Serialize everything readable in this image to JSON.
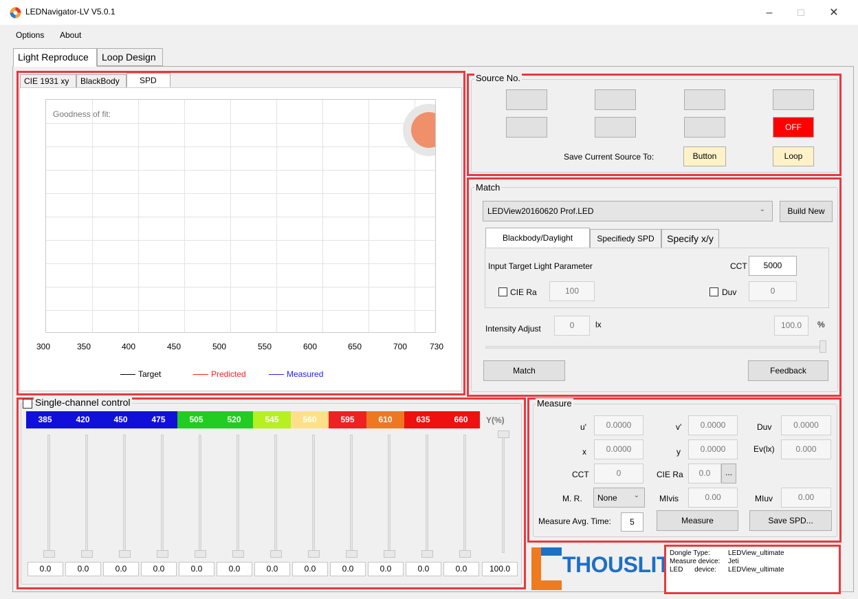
{
  "window": {
    "title": "LEDNavigator-LV V5.0.1",
    "minimize": "–",
    "maximize": "☐",
    "close": "✕"
  },
  "menu": [
    "Options",
    "About"
  ],
  "tabs": [
    "Light Reproduce",
    "Loop Design"
  ],
  "spd": {
    "tabs": [
      "CIE 1931 xy",
      "BlackBody",
      "SPD"
    ],
    "goodness_label": "Goodness of fit:",
    "x_ticks": [
      "300",
      "350",
      "400",
      "450",
      "500",
      "550",
      "600",
      "650",
      "700",
      "730"
    ],
    "legend": [
      {
        "label": "Target",
        "color": "#000000"
      },
      {
        "label": "Predicted",
        "color": "#ff2020"
      },
      {
        "label": "Measured",
        "color": "#2020ff"
      }
    ]
  },
  "source": {
    "title": "Source No.",
    "off_label": "OFF",
    "off_color": "#ff0000",
    "save_label": "Save Current Source To:",
    "button_label": "Button",
    "loop_label": "Loop"
  },
  "match": {
    "title": "Match",
    "led_file": "LEDView20160620 Prof.LED",
    "build_new": "Build New",
    "tabs": [
      "Blackbody/Daylight",
      "Specifiedy SPD",
      "Specify x/y"
    ],
    "input_label": "Input Target Light Parameter",
    "cct_label": "CCT",
    "cct_value": "5000",
    "cie_ra_label": "CIE Ra",
    "cie_ra_value": "100",
    "duv_label": "Duv",
    "duv_value": "0",
    "intensity_label": "Intensity Adjust",
    "intensity_value": "0",
    "intensity_unit": "lx",
    "percent_value": "100.0",
    "percent_unit": "%",
    "match_button": "Match",
    "feedback_button": "Feedback"
  },
  "single": {
    "title": "Single-channel control",
    "channels": [
      {
        "label": "385",
        "color": "#1010d8",
        "value": "0.0"
      },
      {
        "label": "420",
        "color": "#1010d8",
        "value": "0.0"
      },
      {
        "label": "450",
        "color": "#1010d8",
        "value": "0.0"
      },
      {
        "label": "475",
        "color": "#1010d8",
        "value": "0.0"
      },
      {
        "label": "505",
        "color": "#22cc22",
        "value": "0.0"
      },
      {
        "label": "520",
        "color": "#22cc22",
        "value": "0.0"
      },
      {
        "label": "545",
        "color": "#b6f020",
        "value": "0.0"
      },
      {
        "label": "560",
        "color": "#ffe08a",
        "value": "0.0"
      },
      {
        "label": "595",
        "color": "#ee2222",
        "value": "0.0"
      },
      {
        "label": "610",
        "color": "#f07722",
        "value": "0.0"
      },
      {
        "label": "635",
        "color": "#ee1111",
        "value": "0.0"
      },
      {
        "label": "660",
        "color": "#ee1111",
        "value": "0.0"
      }
    ],
    "y_label": "Y(%)",
    "y_value": "100.0"
  },
  "measure": {
    "title": "Measure",
    "u_label": "u'",
    "u_value": "0.0000",
    "v_label": "v'",
    "v_value": "0.0000",
    "duv_label": "Duv",
    "duv_value": "0.0000",
    "x_label": "x",
    "x_value": "0.0000",
    "y_label": "y",
    "y_value": "0.0000",
    "ev_label": "Ev(lx)",
    "ev_value": "0.000",
    "cct_label": "CCT",
    "cct_value": "0",
    "ciera_label": "CIE Ra",
    "ciera_value": "0.0",
    "ellipsis": "...",
    "mr_label": "M. R.",
    "mr_value": "None",
    "mivis_label": "MIvis",
    "mivis_value": "0.00",
    "miuv_label": "MIuv",
    "miuv_value": "0.00",
    "avg_label": "Measure Avg. Time:",
    "avg_value": "5",
    "measure_button": "Measure",
    "save_button": "Save SPD..."
  },
  "brand": "THOUSLITE",
  "dongle": {
    "type_label": "Dongle Type:",
    "type_value": "LEDView_ultimate",
    "device_label": "Measure device:",
    "device_value": "Jeti",
    "led_label": "LED      device:",
    "led_value": "LEDView_ultimate"
  }
}
